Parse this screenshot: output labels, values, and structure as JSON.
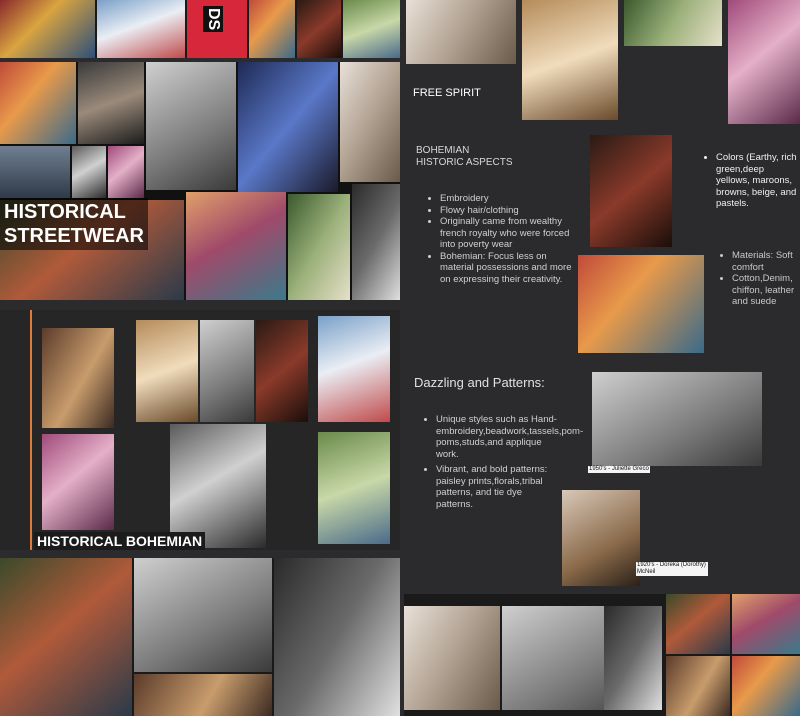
{
  "sections": {
    "streetwear_title": "HISTORICAL STREETWEAR",
    "bohemian_label": "HISTORICAL BOHEMIAN",
    "partial_ds": "DS",
    "free_spirit": "FREE SPIRIT"
  },
  "historic_aspects": {
    "heading_line1": "BOHEMIAN",
    "heading_line2": "HISTORIC ASPECTS",
    "bullets": [
      "Embroidery",
      "Flowy hair/clothing",
      "Originally came from wealthy french royalty who were forced into poverty wear",
      "Bohemian: Focus less on material possessions and more on expressing their creativity."
    ]
  },
  "colors_list": [
    "Colors (Earthy, rich green,deep yellows, maroons, browns, beige, and pastels."
  ],
  "materials_list": [
    "Materials: Soft comfort",
    "Cotton,Denim, chiffon, leather and suede"
  ],
  "dazzling": {
    "heading": "Dazzling and Patterns:",
    "bullets": [
      "Unique styles such as Hand-embroidery,beadwork,tassels,pom-poms,studs,and applique work.",
      "Vibrant, and bold patterns: paisley prints,florals,tribal patterns, and tie dye patterns."
    ]
  },
  "captions": {
    "greco": "1950's - Juliette Greco",
    "mcneil": "1920's - Doreka (Dorothy) McNeil"
  },
  "colors": {
    "background": "#2b2b2d",
    "accent_line": "#e07a3a",
    "text": "#e9e9e9"
  }
}
